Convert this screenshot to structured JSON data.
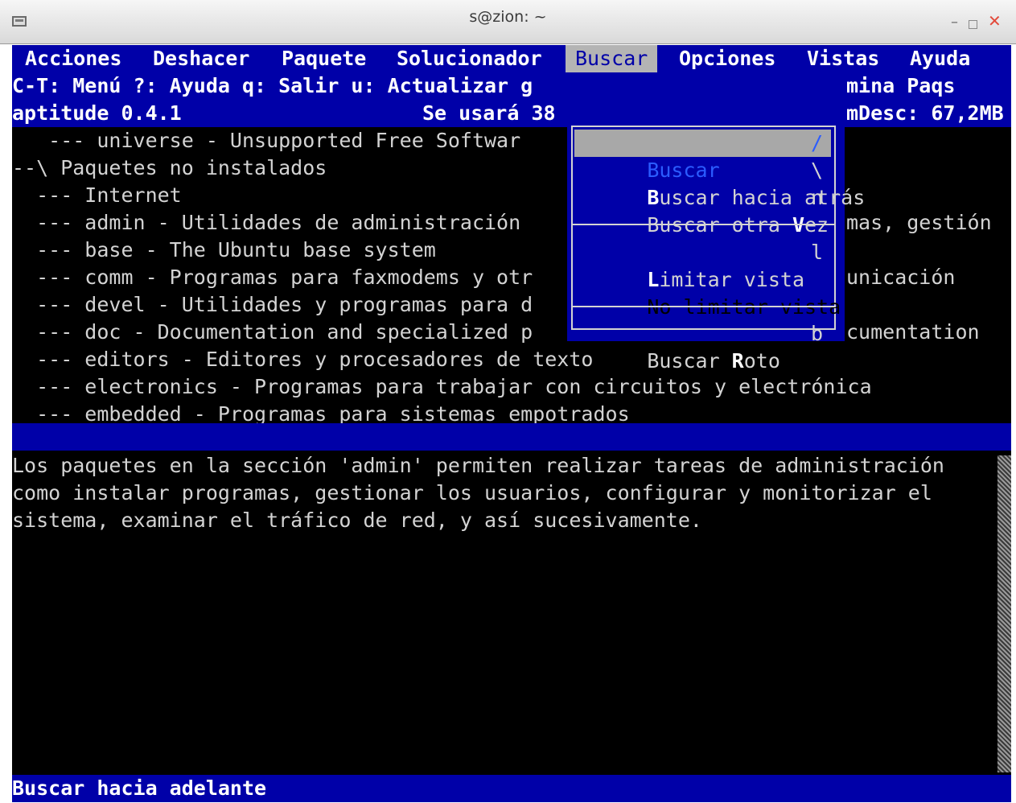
{
  "window": {
    "title": "s@zion: ~",
    "icons": [
      "terminal-icon",
      "minimize-icon",
      "maximize-icon",
      "close-icon"
    ],
    "minimize_glyph": "–",
    "close_glyph": "✕"
  },
  "menubar": {
    "items": [
      "Acciones",
      "Deshacer",
      "Paquete",
      "Solucionador",
      "Buscar",
      "Opciones",
      "Vistas",
      "Ayuda"
    ]
  },
  "hints": {
    "left": "C-T: Menú ?: Ayuda q: Salir u: Actualizar g",
    "right": "mina Paqs"
  },
  "status": {
    "version": "aptitude 0.4.1",
    "usage": "Se usará 38",
    "desc": "mDesc: 67,2MB"
  },
  "tree": [
    {
      "text": "   --- universe - Unsupported Free Softwar",
      "right": ""
    },
    {
      "text": "--\\ Paquetes no instalados",
      "right": ""
    },
    {
      "text": "  --- Internet",
      "right": ""
    },
    {
      "text": "  --- admin - Utilidades de administración ",
      "right": "mas, gestión"
    },
    {
      "text": "  --- base - The Ubuntu base system",
      "right": ""
    },
    {
      "text": "  --- comm - Programas para faxmodems y otr",
      "right": "unicación"
    },
    {
      "text": "  --- devel - Utilidades y programas para d",
      "right": ""
    },
    {
      "text": "  --- doc - Documentation and specialized p",
      "right": "cumentation"
    },
    {
      "text": "  --- editors - Editores y procesadores de texto",
      "right": ""
    },
    {
      "text": "  --- electronics - Programas para trabajar con circuitos y electrónica",
      "right": ""
    },
    {
      "text": "  --- embedded - Programas para sistemas empotrados",
      "right": ""
    }
  ],
  "dropdown": {
    "items": [
      {
        "label": "Buscar",
        "key": "/",
        "state": "selected"
      },
      {
        "label_bold": "B",
        "label_rest": "uscar hacia atrás",
        "key": "\\",
        "state": "normal"
      },
      {
        "label_pre": "Buscar otra ",
        "label_bold": "V",
        "label_rest": "ez",
        "key": "n",
        "state": "normal"
      },
      {
        "label_bold": "L",
        "label_rest": "imitar vista",
        "key": "l",
        "state": "normal"
      },
      {
        "label": "No limitar vista",
        "key": "",
        "state": "disabled"
      },
      {
        "label_pre": "Buscar ",
        "label_bold": "R",
        "label_rest": "oto",
        "key": "b",
        "state": "normal"
      }
    ]
  },
  "description": {
    "lines": [
      "Los paquetes en la sección 'admin' permiten realizar tareas de administración",
      "como instalar programas, gestionar los usuarios, configurar y monitorizar el",
      "sistema, examinar el tráfico de red, y así sucesivamente."
    ]
  },
  "footer": {
    "status": "Buscar hacia adelante"
  }
}
